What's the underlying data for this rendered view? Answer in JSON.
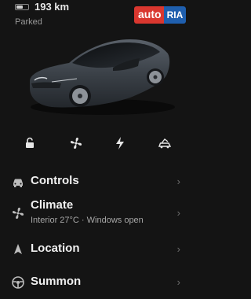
{
  "header": {
    "battery_level": 0.55,
    "range": "193 km",
    "status": "Parked"
  },
  "watermark": {
    "left_text": "auto",
    "right_text": "RIA"
  },
  "vehicle": {
    "body_color": "#3b4148"
  },
  "quick_actions": [
    {
      "icon": "unlock-icon"
    },
    {
      "icon": "fan-icon"
    },
    {
      "icon": "lightning-icon"
    },
    {
      "icon": "car-frunk-icon"
    }
  ],
  "menu": {
    "controls": {
      "label": "Controls",
      "chevron": "›"
    },
    "climate": {
      "label": "Climate",
      "sub": "Interior 27°C · Windows open",
      "chevron": "›"
    },
    "location": {
      "label": "Location",
      "chevron": "›"
    },
    "summon": {
      "label": "Summon",
      "chevron": "›"
    }
  },
  "colors": {
    "background": "#141414",
    "text_primary": "#f0f0f0",
    "text_secondary": "#9a9a9a",
    "brand_red": "#d9372f",
    "brand_blue": "#1f5fae"
  }
}
